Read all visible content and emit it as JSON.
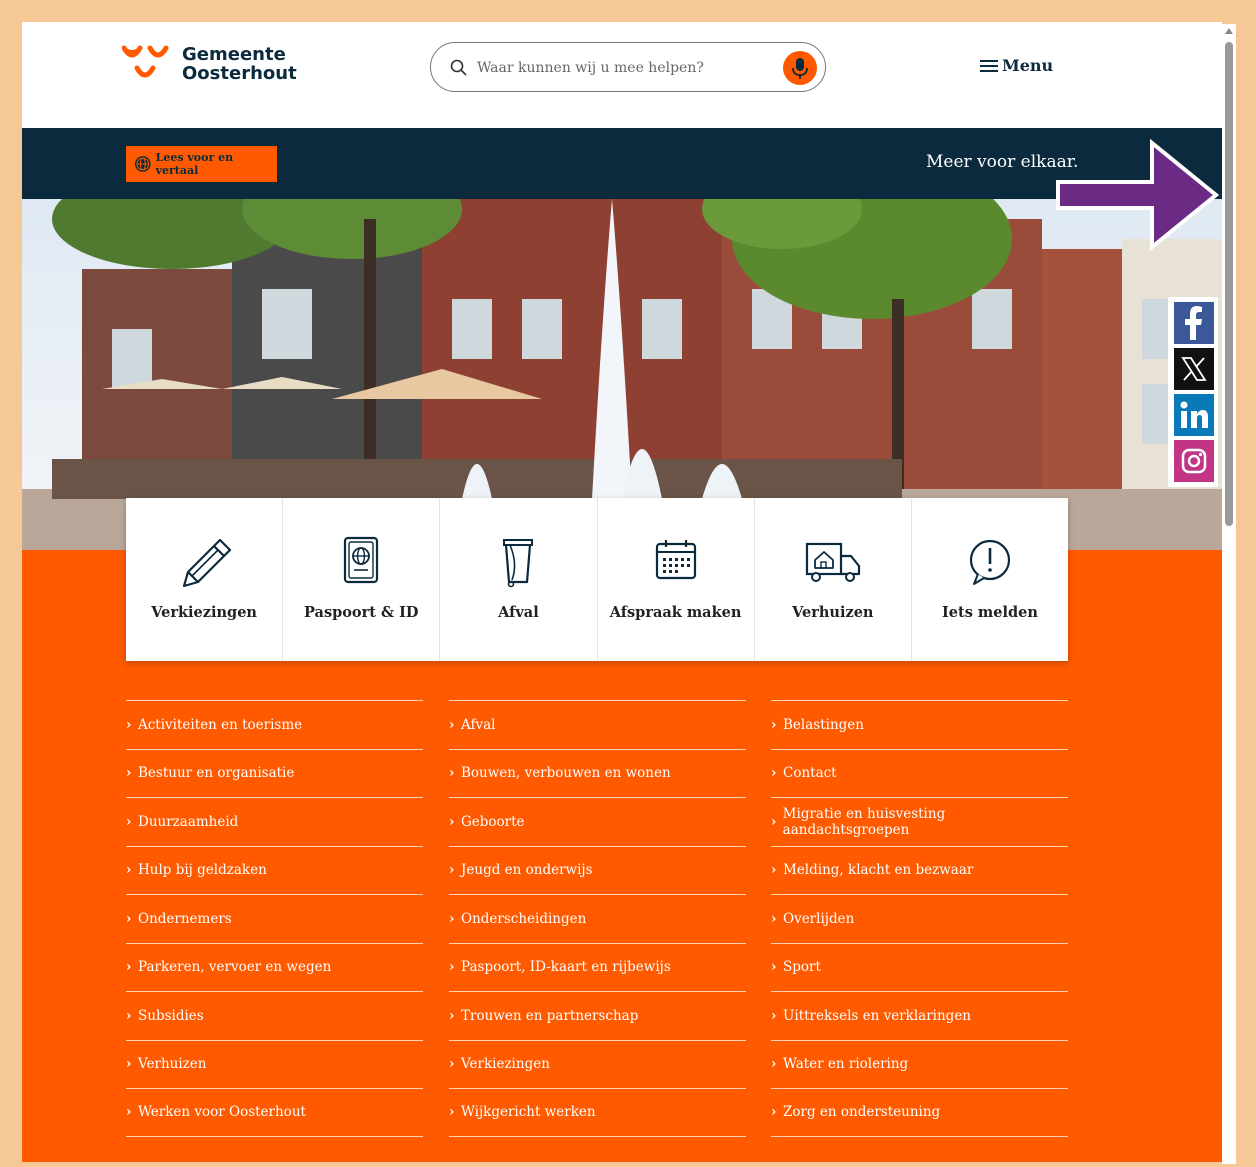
{
  "header": {
    "logo_line1": "Gemeente",
    "logo_line2": "Oosterhout",
    "search_placeholder": "Waar kunnen wij u mee helpen?",
    "menu_label": "Menu"
  },
  "banner": {
    "readspeaker_label": "Lees voor en vertaal",
    "tagline": "Meer voor elkaar."
  },
  "tiles": [
    {
      "label": "Verkiezingen",
      "icon": "pencil-icon"
    },
    {
      "label": "Paspoort & ID",
      "icon": "passport-icon"
    },
    {
      "label": "Afval",
      "icon": "trash-bin-icon"
    },
    {
      "label": "Afspraak maken",
      "icon": "calendar-icon"
    },
    {
      "label": "Verhuizen",
      "icon": "moving-truck-icon"
    },
    {
      "label": "Iets melden",
      "icon": "alert-icon"
    }
  ],
  "links": {
    "col1": [
      "Activiteiten en toerisme",
      "Bestuur en organisatie",
      "Duurzaamheid",
      "Hulp bij geldzaken",
      "Ondernemers",
      "Parkeren, vervoer en wegen",
      "Subsidies",
      "Verhuizen",
      "Werken voor Oosterhout"
    ],
    "col2": [
      "Afval",
      "Bouwen, verbouwen en wonen",
      "Geboorte",
      "Jeugd en onderwijs",
      "Onderscheidingen",
      "Paspoort, ID-kaart en rijbewijs",
      "Trouwen en partnerschap",
      "Verkiezingen",
      "Wijkgericht werken"
    ],
    "col3": [
      "Belastingen",
      "Contact",
      "Migratie en huisvesting aandachtsgroepen",
      "Melding, klacht en bezwaar",
      "Overlijden",
      "Sport",
      "Uittreksels en verklaringen",
      "Water en riolering",
      "Zorg en ondersteuning"
    ]
  },
  "social": [
    "facebook-icon",
    "x-icon",
    "linkedin-icon",
    "instagram-icon"
  ],
  "colors": {
    "brand_orange": "#ff5a00",
    "navy": "#0b2a3d",
    "annotation_arrow": "#6b2a83"
  }
}
